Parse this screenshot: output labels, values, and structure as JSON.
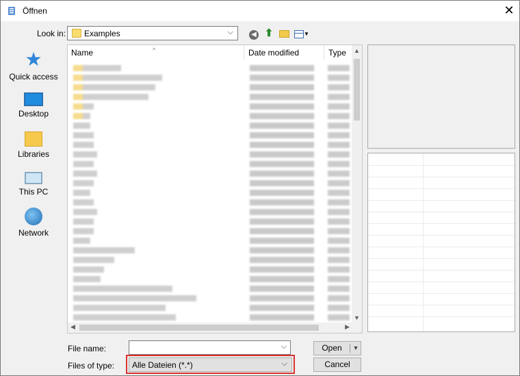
{
  "window": {
    "title": "Öffnen"
  },
  "lookin": {
    "label": "Look in:",
    "value": "Examples"
  },
  "places": [
    {
      "label": "Quick access",
      "icon": "quick-access-icon"
    },
    {
      "label": "Desktop",
      "icon": "desktop-icon"
    },
    {
      "label": "Libraries",
      "icon": "libraries-icon"
    },
    {
      "label": "This PC",
      "icon": "this-pc-icon"
    },
    {
      "label": "Network",
      "icon": "network-icon"
    }
  ],
  "filelist": {
    "columns": [
      "Name",
      "Date modified",
      "Type"
    ]
  },
  "filename": {
    "label": "File name:",
    "value": ""
  },
  "filetype": {
    "label": "Files of type:",
    "value": "Alle Dateien (*.*)"
  },
  "buttons": {
    "open": "Open",
    "cancel": "Cancel"
  },
  "colors": {
    "highlight": "#d8322e",
    "folder": "#f9dc6e",
    "accent": "#2f86d8"
  }
}
